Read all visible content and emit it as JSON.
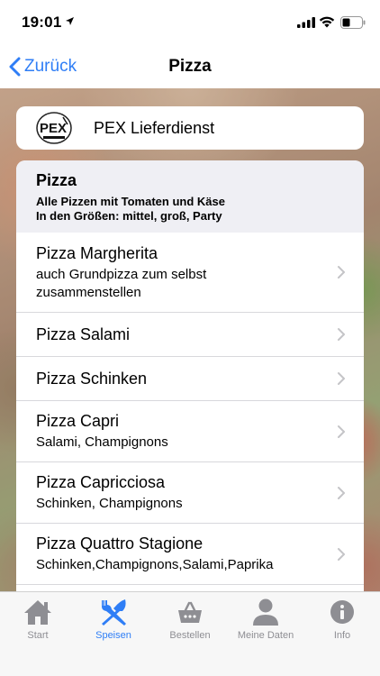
{
  "status_bar": {
    "time": "19:01"
  },
  "nav": {
    "back_label": "Zurück",
    "title": "Pizza"
  },
  "brand": {
    "name": "PEX Lieferdienst",
    "logo_text": "PEX"
  },
  "category": {
    "title": "Pizza",
    "desc_line1": "Alle Pizzen mit Tomaten und Käse",
    "desc_line2": "In den Größen: mittel, groß, Party"
  },
  "items": [
    {
      "title": "Pizza Margherita",
      "sub1": "auch Grundpizza zum selbst",
      "sub2": "zusammenstellen"
    },
    {
      "title": "Pizza Salami"
    },
    {
      "title": "Pizza Schinken"
    },
    {
      "title": "Pizza Capri",
      "sub1": "Salami, Champignons"
    },
    {
      "title": "Pizza Capricciosa",
      "sub1": "Schinken, Champignons"
    },
    {
      "title": "Pizza Quattro Stagione",
      "sub1": "Schinken,Champignons,Salami,Paprika"
    }
  ],
  "tabs": [
    {
      "label": "Start",
      "icon": "home-icon"
    },
    {
      "label": "Speisen",
      "icon": "fork-knife-icon"
    },
    {
      "label": "Bestellen",
      "icon": "basket-icon"
    },
    {
      "label": "Meine Daten",
      "icon": "person-icon"
    },
    {
      "label": "Info",
      "icon": "info-icon"
    }
  ],
  "colors": {
    "accent": "#2f7ef6",
    "inactive_tab": "#8e8e93",
    "category_bg": "#efeff4"
  }
}
